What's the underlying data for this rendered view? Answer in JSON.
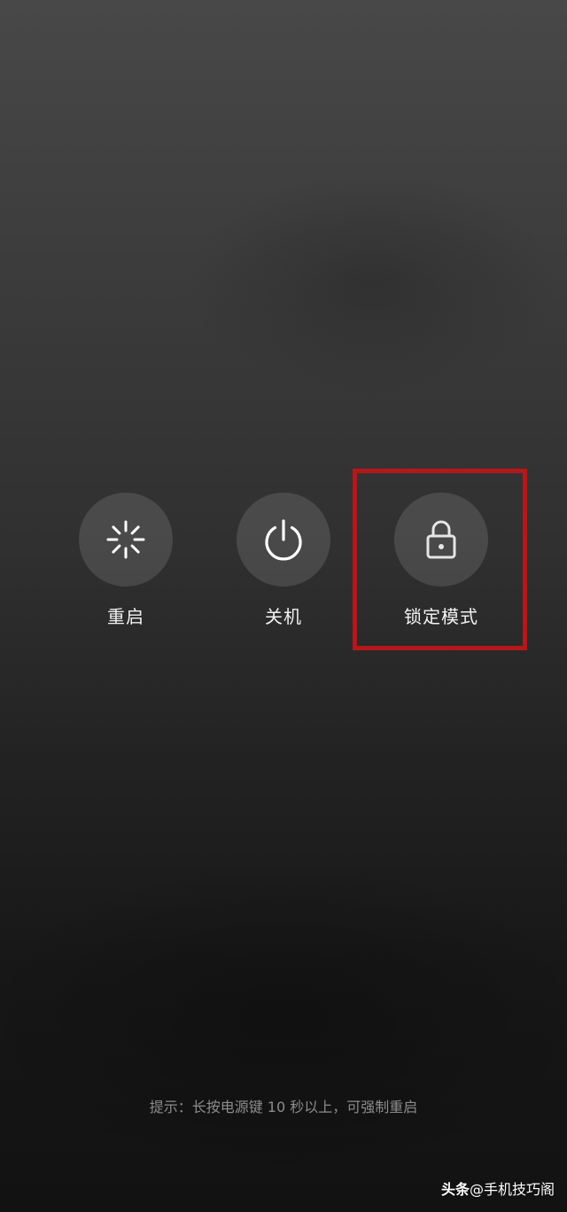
{
  "power_menu": {
    "options": [
      {
        "label": "重启",
        "icon": "restart-icon"
      },
      {
        "label": "关机",
        "icon": "power-icon"
      },
      {
        "label": "锁定模式",
        "icon": "lock-icon"
      }
    ],
    "highlighted_option": "锁定模式",
    "highlight_color": "#b5171b"
  },
  "hint": "提示：长按电源键 10 秒以上，可强制重启",
  "watermark": {
    "brand": "头条",
    "author": "@手机技巧阁"
  }
}
